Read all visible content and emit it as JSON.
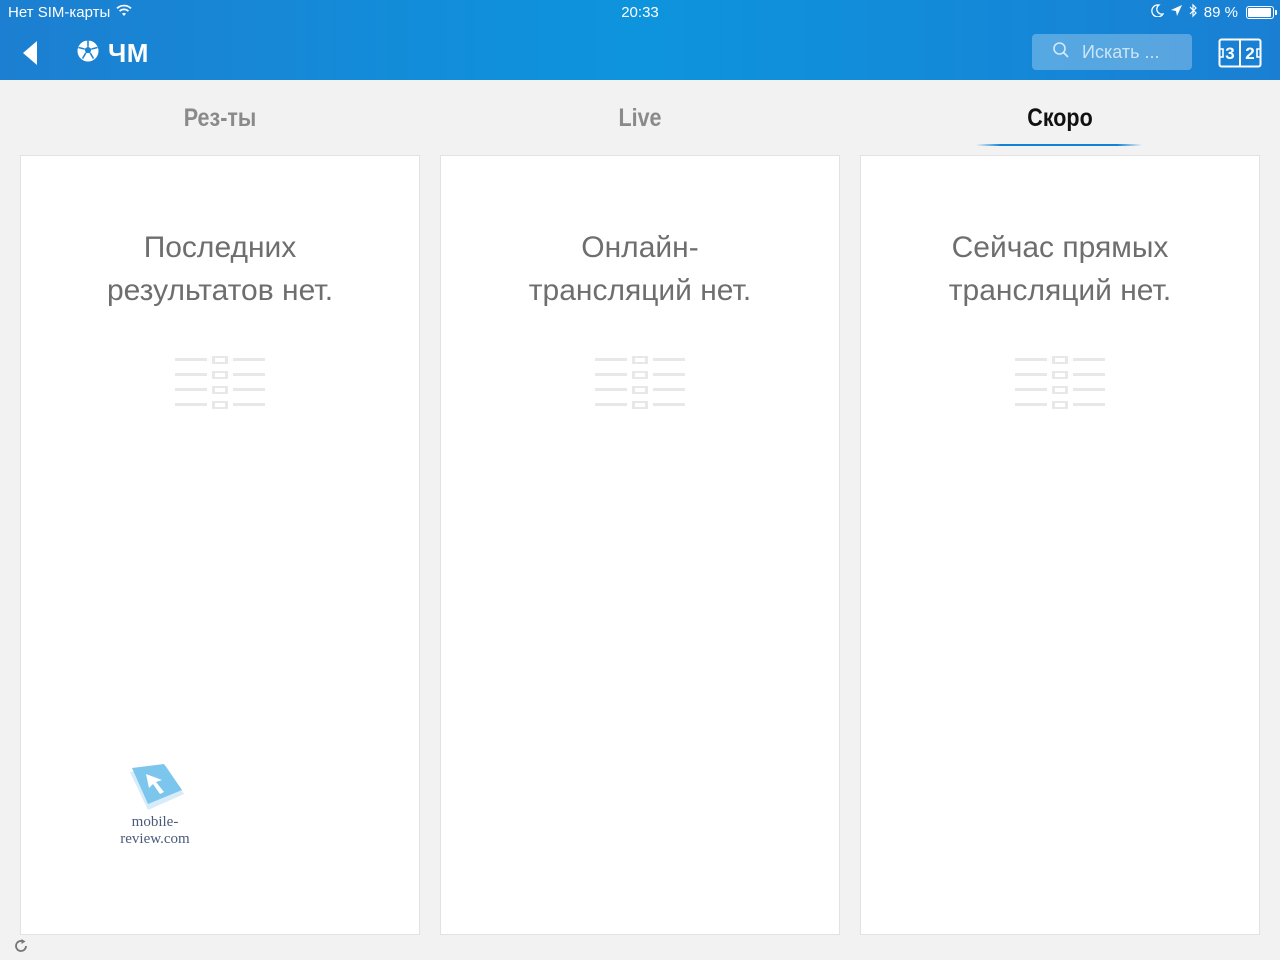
{
  "status_bar": {
    "carrier": "Нет SIM-карты",
    "time": "20:33",
    "battery_text": "89 %",
    "battery_level": 0.89,
    "icons": [
      "wifi-icon",
      "moon-icon",
      "location-arrow-icon",
      "bluetooth-icon",
      "battery-icon"
    ]
  },
  "nav": {
    "title": "ЧМ",
    "back_icon": "back-arrow-icon",
    "title_icon": "soccer-ball-icon",
    "search_placeholder": "Искать ...",
    "scoreboard_icon": "scoreboard-icon"
  },
  "tabs": [
    {
      "label": "Рез-ты",
      "active": false
    },
    {
      "label": "Live",
      "active": false
    },
    {
      "label": "Скоро",
      "active": true
    }
  ],
  "panels": [
    {
      "line1": "Последних",
      "line2": "результатов нет."
    },
    {
      "line1": "Онлайн-",
      "line2": "трансляций нет."
    },
    {
      "line1": "Сейчас прямых",
      "line2": "трансляций нет."
    }
  ],
  "watermark": {
    "text": "mobile-review.com"
  },
  "colors": {
    "header_blue": "#0d94dd",
    "accent": "#1282d7",
    "background": "#f2f2f2"
  }
}
